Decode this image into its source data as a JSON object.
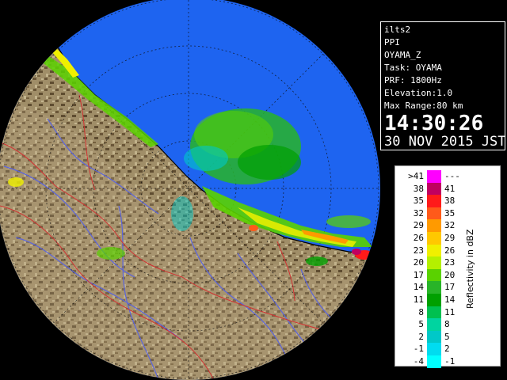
{
  "radar_info": {
    "system": "ilts2",
    "scan_type": "PPI",
    "product": "OYAMA_Z",
    "task": "Task: OYAMA",
    "prf": "PRF: 1800Hz",
    "elevation": "Elevation:1.0",
    "max_range": "Max Range:80 km",
    "time": "14:30:26",
    "date": "30 NOV 2015 JST"
  },
  "legend": {
    "unit_label": "Reflectivity in dBZ",
    "rows": [
      {
        "low": ">41",
        "high": "---",
        "color": "#ff00ff"
      },
      {
        "low": "38",
        "high": "41",
        "color": "#c00060"
      },
      {
        "low": "35",
        "high": "38",
        "color": "#ff1a1a"
      },
      {
        "low": "32",
        "high": "35",
        "color": "#ff5a1a"
      },
      {
        "low": "29",
        "high": "32",
        "color": "#ff9a00"
      },
      {
        "low": "26",
        "high": "29",
        "color": "#ffc800"
      },
      {
        "low": "23",
        "high": "26",
        "color": "#f0f000"
      },
      {
        "low": "20",
        "high": "23",
        "color": "#b4f000"
      },
      {
        "low": "17",
        "high": "20",
        "color": "#5ad200"
      },
      {
        "low": "14",
        "high": "17",
        "color": "#28b428"
      },
      {
        "low": "11",
        "high": "14",
        "color": "#00a000"
      },
      {
        "low": "8",
        "high": "11",
        "color": "#00c050"
      },
      {
        "low": "5",
        "high": "8",
        "color": "#00d4a0"
      },
      {
        "low": "2",
        "high": "5",
        "color": "#00c8c8"
      },
      {
        "low": "-1",
        "high": "2",
        "color": "#00dcf0"
      },
      {
        "low": "-4",
        "high": "-1",
        "color": "#00ffff"
      }
    ]
  },
  "colors": {
    "sea": "#1e64f0",
    "land": "#9c8a64",
    "border": "#d23232",
    "river": "#5a64dc",
    "background": "#000000"
  }
}
